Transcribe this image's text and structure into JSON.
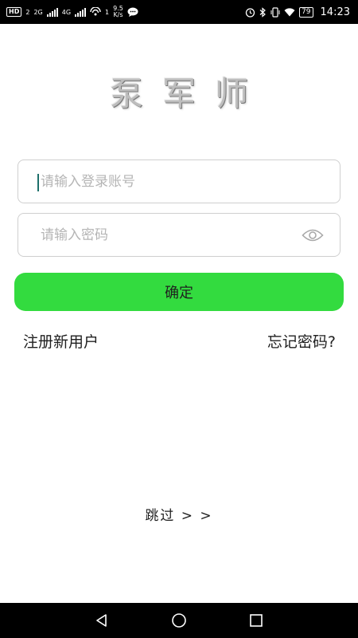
{
  "status_bar": {
    "hd_badge": "HD",
    "sim1": "2",
    "network_2g": "2G",
    "network_4g": "4G",
    "hotspot_count": "1",
    "speed_value": "9.5",
    "speed_unit": "K/s",
    "battery": "79",
    "time": "14:23"
  },
  "app": {
    "title": "泵军师"
  },
  "login": {
    "account_placeholder": "请输入登录账号",
    "password_placeholder": "请输入密码",
    "confirm_label": "确定"
  },
  "links": {
    "register": "注册新用户",
    "forgot_password": "忘记密码?",
    "skip": "跳过 > >"
  },
  "colors": {
    "accent_green": "#33db3f",
    "caret": "#1d6f6a"
  }
}
